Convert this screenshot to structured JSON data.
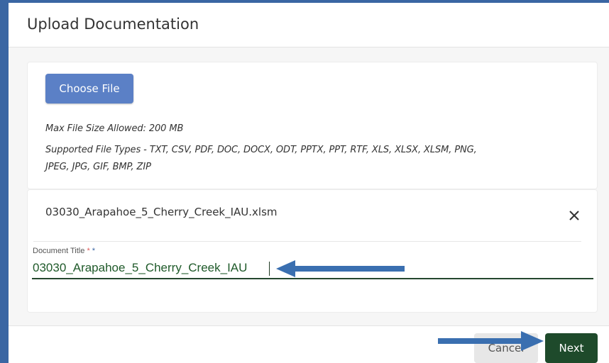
{
  "dialog": {
    "title": "Upload Documentation"
  },
  "upload": {
    "choose_file_label": "Choose File",
    "max_size_text": "Max File Size Allowed: 200 MB",
    "supported_types_line1": "Supported File Types - TXT, CSV, PDF, DOC, DOCX, ODT, PPTX, PPT, RTF, XLS, XLSX, XLSM, PNG,",
    "supported_types_line2": "JPEG, JPG, GIF, BMP, ZIP"
  },
  "file": {
    "name": "03030_Arapahoe_5_Cherry_Creek_IAU.xlsm",
    "close_icon": "close-icon",
    "title_label": "Document Title",
    "required_marks": [
      "*",
      "*"
    ],
    "title_value": "03030_Arapahoe_5_Cherry_Creek_IAU"
  },
  "footer": {
    "cancel_label": "Cancel",
    "next_label": "Next"
  },
  "annotations": {
    "arrow_icon": "arrow-left-icon",
    "arrow_icon_2": "arrow-right-icon"
  },
  "colors": {
    "frame": "#3a66a3",
    "primary_button": "#5b80c6",
    "next_button": "#1e4a2b",
    "input_text": "#1f5a2a",
    "annotation_arrow": "#3a6fb0"
  }
}
